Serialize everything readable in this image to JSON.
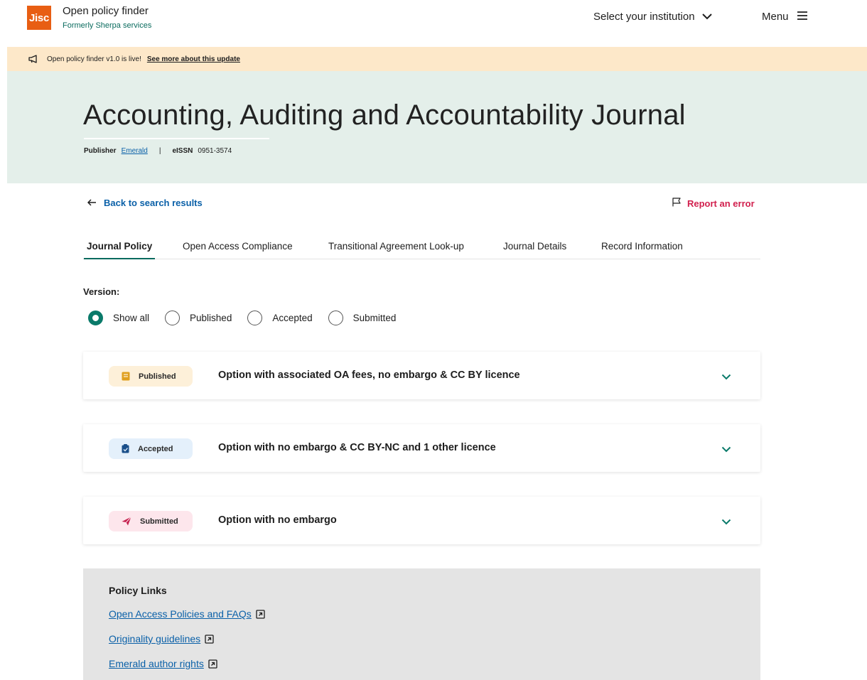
{
  "header": {
    "logo_text": "Jisc",
    "brand_title": "Open policy finder",
    "brand_subtitle": "Formerly Sherpa services",
    "institution_select": "Select your institution",
    "menu_label": "Menu"
  },
  "banner": {
    "text": "Open policy finder v1.0 is live!",
    "link": "See more about this update"
  },
  "journal": {
    "title": "Accounting, Auditing and Accountability Journal",
    "publisher_label": "Publisher",
    "publisher": "Emerald",
    "separator": "|",
    "eissn_label": "eISSN",
    "eissn": "0951-3574"
  },
  "nav": {
    "back": "Back to search results",
    "report": "Report an error"
  },
  "tabs": [
    {
      "label": "Journal Policy",
      "active": true
    },
    {
      "label": "Open Access Compliance",
      "active": false
    },
    {
      "label": "Transitional Agreement Look-up",
      "active": false
    },
    {
      "label": "Journal Details",
      "active": false
    },
    {
      "label": "Record Information",
      "active": false
    }
  ],
  "version": {
    "label": "Version:",
    "options": [
      {
        "label": "Show all",
        "checked": true
      },
      {
        "label": "Published",
        "checked": false
      },
      {
        "label": "Accepted",
        "checked": false
      },
      {
        "label": "Submitted",
        "checked": false
      }
    ]
  },
  "options": [
    {
      "badge": "Published",
      "badge_bg": "#fdf0d9",
      "icon_color": "#e0a020",
      "icon": "book-icon",
      "title": "Option with associated OA fees, no embargo & CC BY licence"
    },
    {
      "badge": "Accepted",
      "badge_bg": "#e4f0fb",
      "icon_color": "#1a4f8a",
      "icon": "clipboard-check-icon",
      "title": "Option with no embargo & CC BY-NC and 1 other licence"
    },
    {
      "badge": "Submitted",
      "badge_bg": "#fde6ec",
      "icon_color": "#c5214f",
      "icon": "paper-plane-icon",
      "title": "Option with no embargo"
    }
  ],
  "policy_links": {
    "heading": "Policy Links",
    "links": [
      "Open Access Policies and FAQs",
      "Originality guidelines",
      "Emerald author rights"
    ]
  },
  "colors": {
    "jisc_orange": "#e85e13",
    "teal": "#0a6b5e",
    "link_blue": "#0a60a8",
    "report_red": "#d11f4d",
    "banner_bg": "#fde8c9",
    "hero_bg": "#e4efea",
    "policy_bg": "#e4e4e4"
  }
}
